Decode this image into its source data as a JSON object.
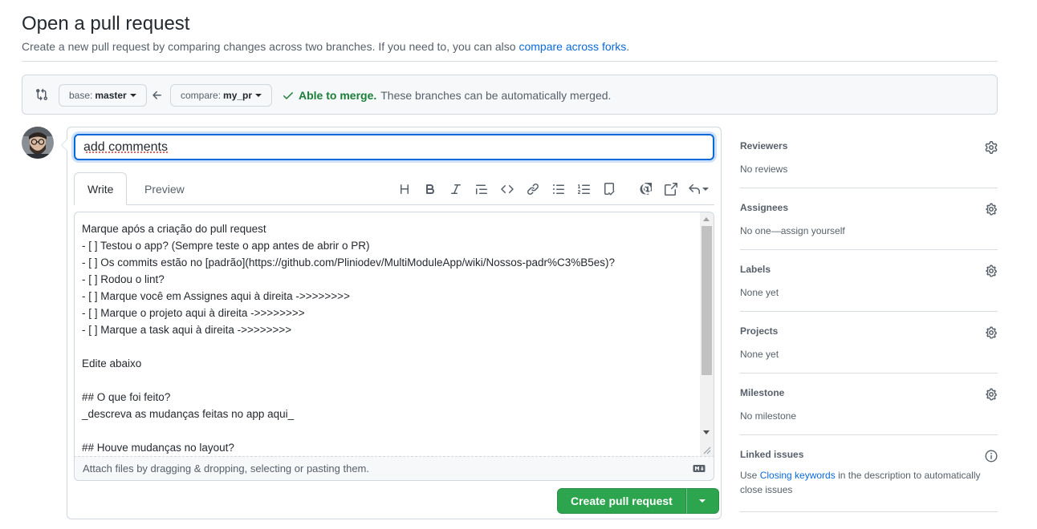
{
  "header": {
    "title": "Open a pull request",
    "description": "Create a new pull request by comparing changes across two branches. If you need to, you can also",
    "compare_forks_link": "compare across forks",
    "description_end": "."
  },
  "range": {
    "base_label": "base:",
    "base_branch": "master",
    "compare_label": "compare:",
    "compare_branch": "my_pr",
    "merge_ok": "Able to merge.",
    "merge_detail": "These branches can be automatically merged."
  },
  "composer": {
    "title_value": "add comments",
    "tabs": [
      {
        "label": "Write"
      },
      {
        "label": "Preview"
      }
    ],
    "body": "Marque após a criação do pull request\n- [ ] Testou o app? (Sempre teste o app antes de abrir o PR)\n- [ ] Os commits estão no [padrão](https://github.com/Pliniodev/MultiModuleApp/wiki/Nossos-padr%C3%B5es)?\n- [ ] Rodou o lint?\n- [ ] Marque você em Assignes aqui à direita ->>>>>>>>\n- [ ] Marque o projeto aqui à direita ->>>>>>>>\n- [ ] Marque a task aqui à direita ->>>>>>>>\n\nEdite abaixo\n\n## O que foi feito?\n_descreva as mudanças feitas no app aqui_\n\n## Houve mudanças no layout?",
    "attach_text": "Attach files by dragging & dropping, selecting or pasting them.",
    "create_label": "Create pull request"
  },
  "toolbar": {
    "icons": [
      "heading-icon",
      "bold-icon",
      "italic-icon",
      "quote-icon",
      "code-icon",
      "link-icon",
      "unordered-list-icon",
      "ordered-list-icon",
      "task-list-icon",
      "mention-icon",
      "reference-icon",
      "reply-icon"
    ]
  },
  "sidebar": {
    "reviewers": {
      "title": "Reviewers",
      "value": "No reviews"
    },
    "assignees": {
      "title": "Assignees",
      "value": "No one—assign yourself"
    },
    "labels": {
      "title": "Labels",
      "value": "None yet"
    },
    "projects": {
      "title": "Projects",
      "value": "None yet"
    },
    "milestone": {
      "title": "Milestone",
      "value": "No milestone"
    },
    "linked": {
      "title": "Linked issues",
      "value_pre": "Use",
      "value_link": "Closing keywords",
      "value_post": "in the description to automatically close issues"
    }
  },
  "colors": {
    "accent": "#0969da",
    "success": "#2da44e",
    "merge_ok": "#1a7f37"
  }
}
